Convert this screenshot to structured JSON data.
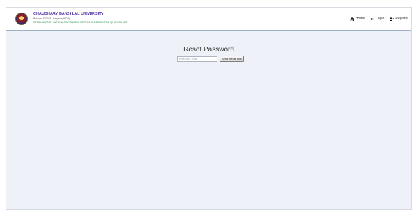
{
  "header": {
    "brand_name": "CHAUDHARY BANSI LAL UNIVERSITY",
    "brand_location": "Bhiwani-127021, Haryana(INDIA)",
    "brand_tagline": "ESTABLISHED BY HARYANA GOVERNMENT NOTIFIED UNDER SECTION 2(f) OF UGC ACT"
  },
  "nav": {
    "items": [
      {
        "label": "Home",
        "icon": "home-icon"
      },
      {
        "label": "Login",
        "icon": "login-icon"
      },
      {
        "label": "Register",
        "icon": "user-plus-icon"
      }
    ]
  },
  "main": {
    "title": "Reset Password",
    "email_placeholder": "Enter your email",
    "email_value": "",
    "send_label": "Send Reset Link"
  },
  "colors": {
    "background": "#eef2f8",
    "brand": "#4b2aa0",
    "tagline": "#1a8a3c"
  }
}
